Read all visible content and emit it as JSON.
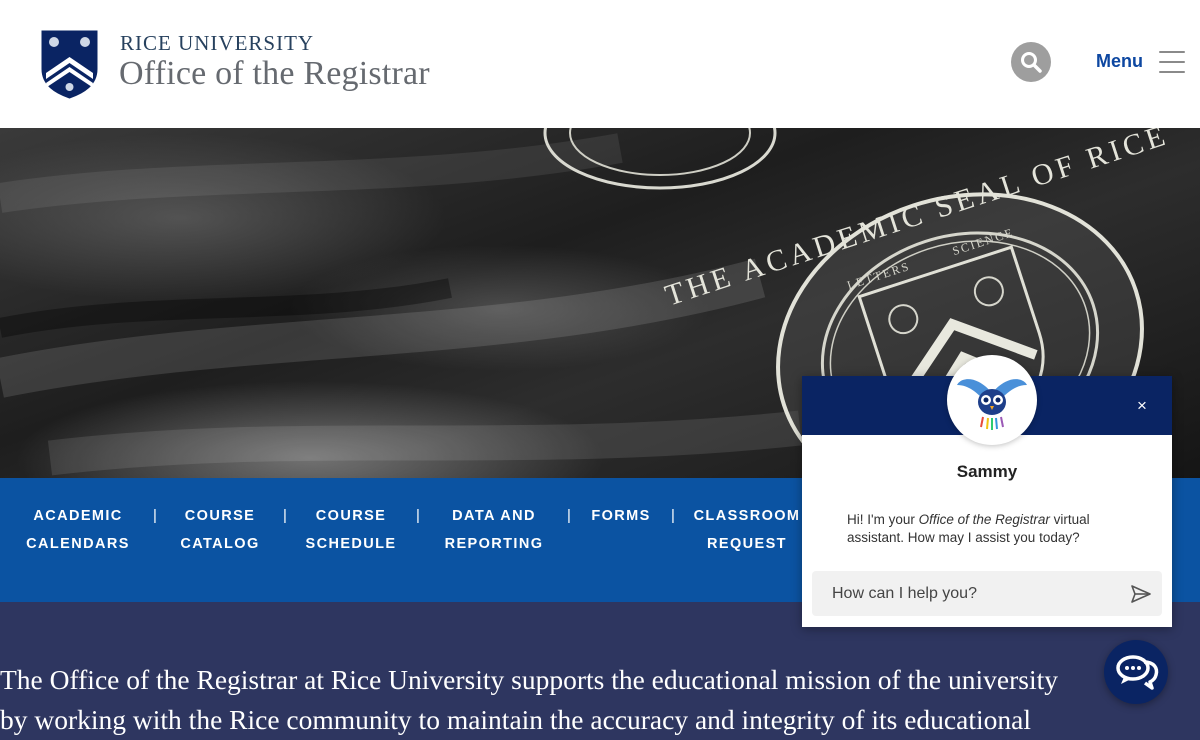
{
  "header": {
    "university": "RICE UNIVERSITY",
    "office": "Office of the Registrar",
    "menu_label": "Menu"
  },
  "hero": {
    "seal_text": "THE ACADEMIC SEAL OF RICE",
    "seal_inner_left": "LETTERS",
    "seal_inner_right": "SCIENCE"
  },
  "nav": {
    "items": [
      {
        "line1": "ACADEMIC",
        "line2": "CALENDARS"
      },
      {
        "line1": "COURSE",
        "line2": "CATALOG"
      },
      {
        "line1": "COURSE",
        "line2": "SCHEDULE"
      },
      {
        "line1": "DATA AND",
        "line2": "REPORTING"
      },
      {
        "line1": "FORMS",
        "line2": ""
      },
      {
        "line1": "CLASSROOM",
        "line2": "REQUEST"
      }
    ],
    "separator": "|"
  },
  "intro": {
    "line1": "The Office of the Registrar at Rice University supports the educational mission of the university",
    "line2": "by working with the Rice community to maintain the accuracy and integrity of its educational"
  },
  "chat": {
    "close_label": "×",
    "bot_name": "Sammy",
    "msg_prefix": "Hi! I'm your ",
    "msg_em": "Office of the Registrar",
    "msg_suffix": " virtual assistant. How may I assist you today?",
    "input_placeholder": "How can I help you?"
  },
  "colors": {
    "brand_navy": "#0a2463",
    "nav_blue": "#0b53a2",
    "intro_bg": "#2e3660",
    "menu_text": "#0d47a1"
  },
  "icons": {
    "logo": "rice-shield-logo-icon",
    "search": "search-icon",
    "menu": "hamburger-icon",
    "close": "close-icon",
    "avatar": "owl-bot-icon",
    "send": "send-icon",
    "launcher": "chat-bubbles-icon"
  }
}
